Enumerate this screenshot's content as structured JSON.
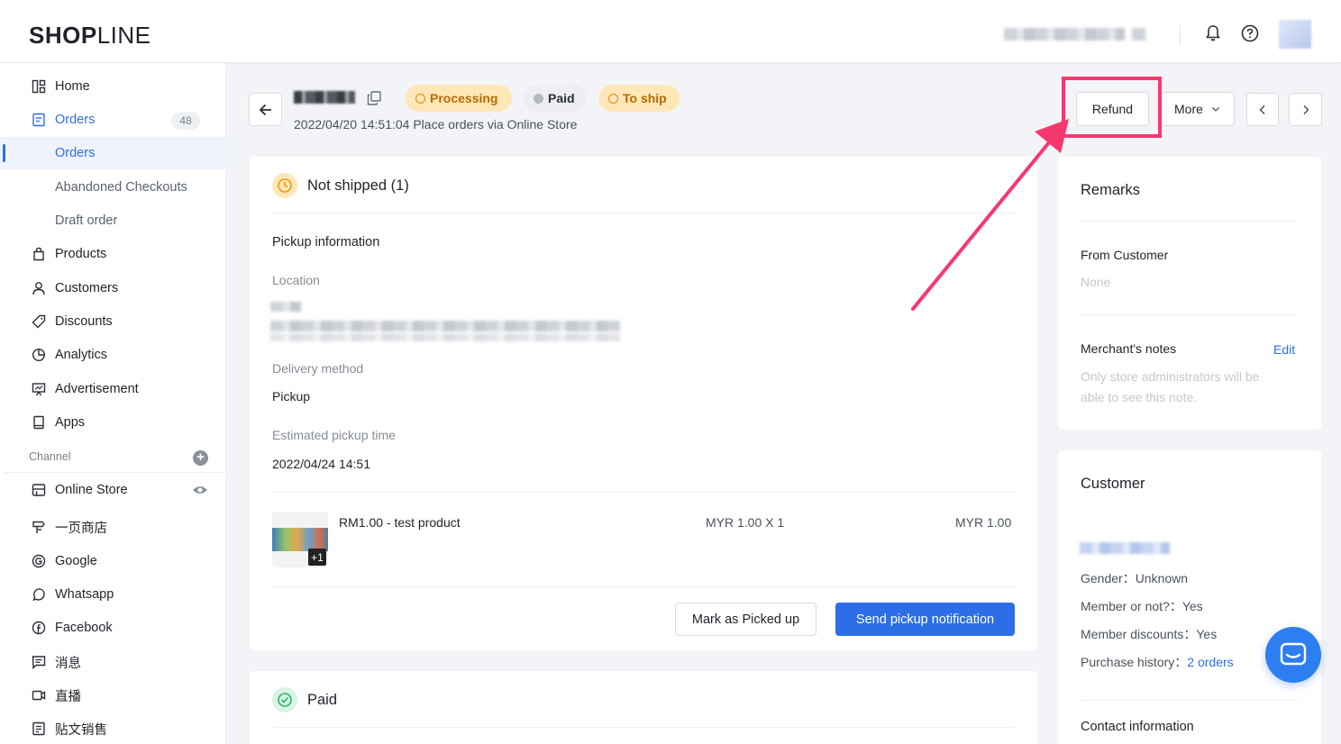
{
  "app": {
    "logo_bold": "SHOP",
    "logo_light": "LINE"
  },
  "sidebar": {
    "items": [
      {
        "label": "Home",
        "icon": "home-icon"
      },
      {
        "label": "Orders",
        "icon": "orders-icon",
        "badge": "48"
      },
      {
        "label": "Orders"
      },
      {
        "label": "Abandoned Checkouts"
      },
      {
        "label": "Draft order"
      },
      {
        "label": "Products",
        "icon": "bag-icon"
      },
      {
        "label": "Customers",
        "icon": "user-icon"
      },
      {
        "label": "Discounts",
        "icon": "tag-icon"
      },
      {
        "label": "Analytics",
        "icon": "pie-chart-icon"
      },
      {
        "label": "Advertisement",
        "icon": "presentation-icon"
      },
      {
        "label": "Apps",
        "icon": "tablet-icon"
      }
    ],
    "channel_label": "Channel",
    "channels": [
      {
        "label": "Online Store",
        "icon": "store-icon"
      },
      {
        "label": "一页商店",
        "icon": "signpost-icon"
      },
      {
        "label": "Google",
        "icon": "google-icon"
      },
      {
        "label": "Whatsapp",
        "icon": "whatsapp-icon"
      },
      {
        "label": "Facebook",
        "icon": "facebook-icon"
      },
      {
        "label": "消息",
        "icon": "message-icon"
      },
      {
        "label": "直播",
        "icon": "video-icon"
      },
      {
        "label": "贴文销售",
        "icon": "post-icon"
      }
    ]
  },
  "header": {
    "tags": {
      "processing": "Processing",
      "paid": "Paid",
      "to_ship": "To ship"
    },
    "meta": "2022/04/20 14:51:04 Place orders via Online Store",
    "refund": "Refund",
    "more": "More"
  },
  "shipment": {
    "title": "Not shipped (1)",
    "pickup_info": "Pickup information",
    "location_label": "Location",
    "delivery_label": "Delivery method",
    "delivery_value": "Pickup",
    "pickup_time_label": "Estimated pickup time",
    "pickup_time_value": "2022/04/24 14:51",
    "product": {
      "name": "RM1.00 - test product",
      "qty": "MYR 1.00 X 1",
      "total": "MYR 1.00",
      "extra": "+1"
    },
    "mark_picked": "Mark as Picked up",
    "send_notification": "Send pickup notification"
  },
  "payment": {
    "title": "Paid"
  },
  "remarks": {
    "title": "Remarks",
    "from_customer_label": "From Customer",
    "from_customer_value": "None",
    "merchant_notes_label": "Merchant's notes",
    "edit": "Edit",
    "merchant_notes_hint_1": "Only store administrators will be",
    "merchant_notes_hint_2": "able to see this note."
  },
  "customer": {
    "title": "Customer",
    "gender": "Gender：Unknown",
    "member": "Member or not?：Yes",
    "member_discounts": "Member discounts：Yes",
    "purchase_history_label": "Purchase history：",
    "purchase_history_link": "2 orders",
    "contact_title": "Contact information"
  },
  "colors": {
    "accent": "#2d6ee8",
    "annotation": "#f7386f",
    "processing_bg": "#ffe7b8",
    "processing_text": "#b86a00"
  }
}
